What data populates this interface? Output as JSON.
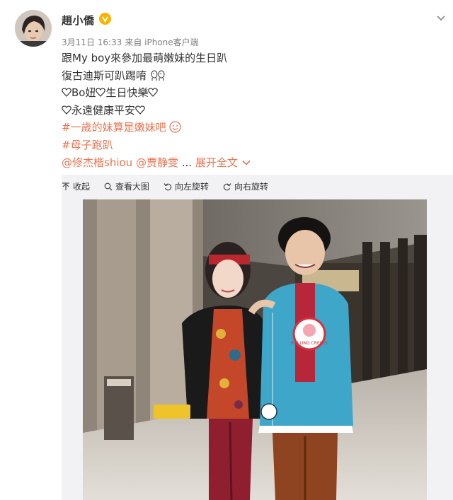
{
  "user": {
    "name": "趙小僑",
    "verified_badge": "V",
    "avatar": "avatar-photo"
  },
  "meta": {
    "date": "3月11日 16:33",
    "source": "来自 iPhone客户端"
  },
  "post": {
    "line1": "跟My boy來參加最萌嫩妹的生日趴",
    "line2": "復古迪斯可趴踢唷",
    "line3": "Bo妞",
    "line3b": "生日快樂",
    "line4": "永遠健康平安",
    "topic1": "#一歲的妹算是嫩妹吧",
    "topic2": "#母子跑趴",
    "mention1": "@修杰楷shiou",
    "mention2": "@贾静雯",
    "ellipsis": "...",
    "expand": "展开全文"
  },
  "toolbar": {
    "collapse": "收起",
    "view_large": "查看大图",
    "rotate_left": "向左旋转",
    "rotate_right": "向右旋转"
  },
  "photo": {
    "badge_text": "ROLLING CREPES"
  },
  "colors": {
    "link": "#eb7350",
    "meta": "#808080",
    "verified": "#f7b500",
    "media_bg": "#f2f2f5"
  }
}
